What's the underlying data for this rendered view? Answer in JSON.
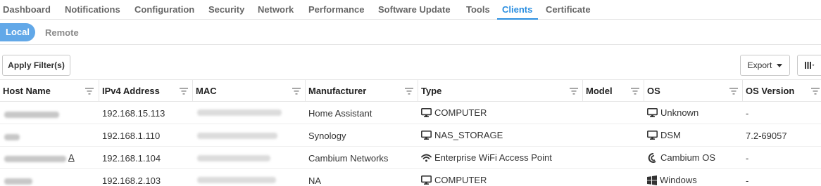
{
  "topnav": {
    "tabs": [
      {
        "label": "Dashboard"
      },
      {
        "label": "Notifications"
      },
      {
        "label": "Configuration"
      },
      {
        "label": "Security"
      },
      {
        "label": "Network"
      },
      {
        "label": "Performance"
      },
      {
        "label": "Software Update"
      },
      {
        "label": "Tools"
      },
      {
        "label": "Clients"
      },
      {
        "label": "Certificate"
      }
    ],
    "active": "Clients"
  },
  "subtabs": {
    "local": "Local",
    "remote": "Remote",
    "active": "Local"
  },
  "toolbar": {
    "apply_filters": "Apply Filter(s)",
    "export": "Export",
    "columns_icon": "column-chooser-icon"
  },
  "table": {
    "columns": [
      {
        "label": "Host Name"
      },
      {
        "label": "IPv4 Address"
      },
      {
        "label": "MAC"
      },
      {
        "label": "Manufacturer"
      },
      {
        "label": "Type"
      },
      {
        "label": "Model"
      },
      {
        "label": "OS"
      },
      {
        "label": "OS Version"
      }
    ],
    "rows": [
      {
        "ip": "192.168.15.113",
        "manufacturer": "Home Assistant",
        "type": "COMPUTER",
        "type_icon": "monitor-icon",
        "model": "",
        "os": "Unknown",
        "os_icon": "monitor-icon",
        "os_version": "-"
      },
      {
        "ip": "192.168.1.110",
        "manufacturer": "Synology",
        "type": "NAS_STORAGE",
        "type_icon": "monitor-icon",
        "model": "",
        "os": "DSM",
        "os_icon": "monitor-icon",
        "os_version": "7.2-69057"
      },
      {
        "ip": "192.168.1.104",
        "host_suffix": "A",
        "manufacturer": "Cambium Networks",
        "type": "Enterprise WiFi Access Point",
        "type_icon": "wifi-icon",
        "model": "",
        "os": "Cambium OS",
        "os_icon": "cambium-logo-icon",
        "os_version": "-"
      },
      {
        "ip": "192.168.2.103",
        "manufacturer": "NA",
        "type": "COMPUTER",
        "type_icon": "monitor-icon",
        "model": "",
        "os": "Windows",
        "os_icon": "windows-icon",
        "os_version": "-"
      }
    ]
  },
  "colors": {
    "accent": "#2a8ee0",
    "pill": "#62a8e8"
  }
}
